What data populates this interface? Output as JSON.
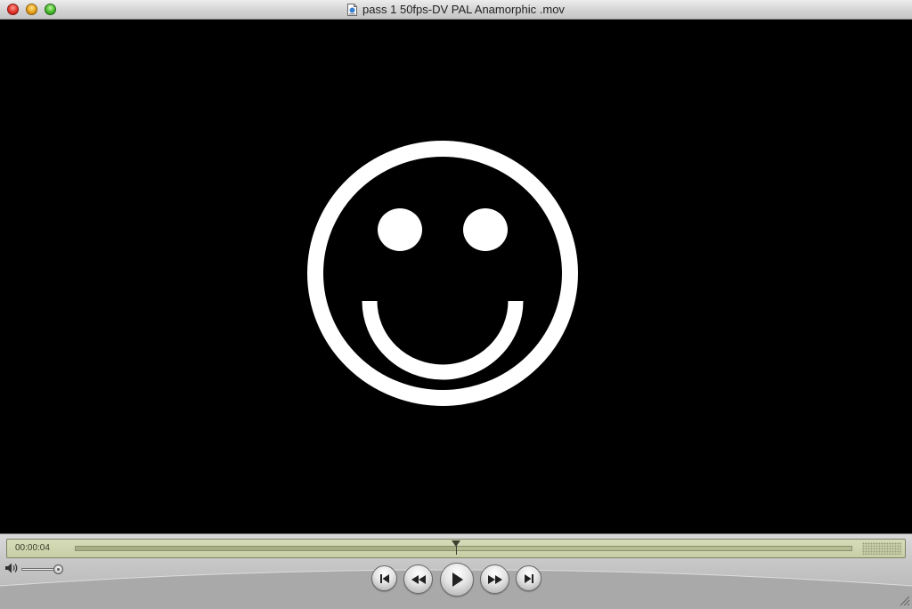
{
  "window": {
    "title": "pass 1 50fps-DV PAL Anamorphic .mov",
    "title_icon": "movie-document-icon",
    "buttons": [
      "close",
      "minimize",
      "zoom"
    ]
  },
  "video": {
    "content": "smiley-face"
  },
  "controller": {
    "timecode": "00:00:04",
    "playback_progress": 0.49,
    "volume_level": 1.0,
    "transport": [
      {
        "name": "go-to-start",
        "icon": "skip-to-start-icon"
      },
      {
        "name": "rewind",
        "icon": "rewind-icon"
      },
      {
        "name": "play",
        "icon": "play-icon"
      },
      {
        "name": "fast-forward",
        "icon": "fast-forward-icon"
      },
      {
        "name": "go-to-end",
        "icon": "skip-to-end-icon"
      }
    ]
  },
  "colors": {
    "lcd_background": "#cdd3ad",
    "controller_background": "#c4c4c4",
    "video_background": "#000000",
    "smiley": "#ffffff"
  }
}
